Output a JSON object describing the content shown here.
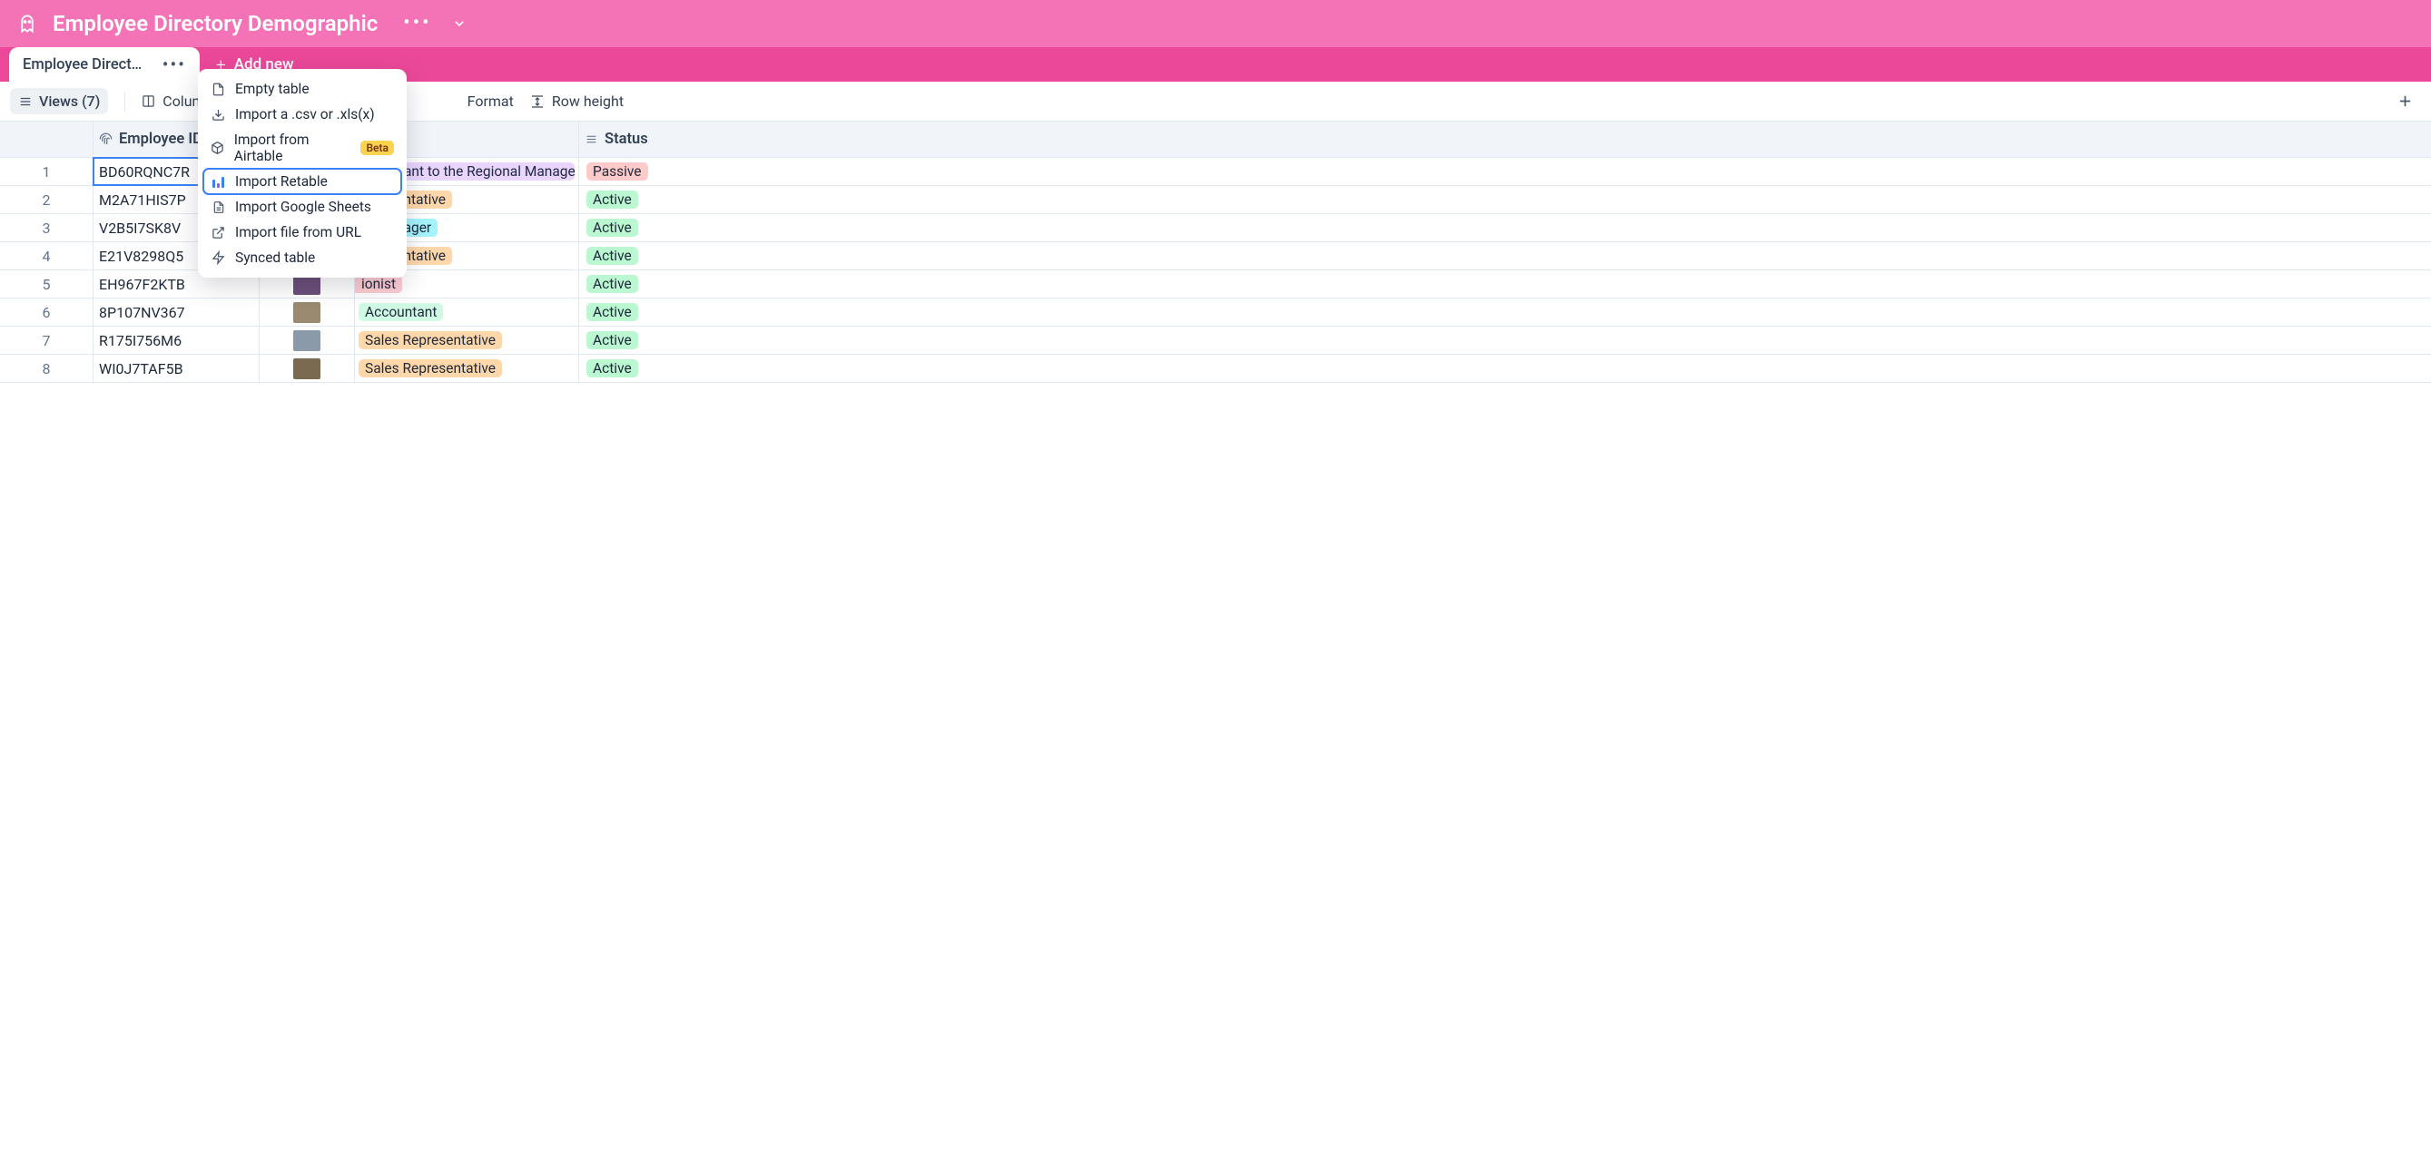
{
  "header": {
    "title": "Employee Directory Demographic"
  },
  "tabs": {
    "active": "Employee Directory Demog...",
    "add_new": "Add new"
  },
  "toolbar": {
    "views_label": "Views (7)",
    "columns": "Columns",
    "format": "Format",
    "row_height": "Row height"
  },
  "dropdown": {
    "empty_table": "Empty table",
    "import_csv": "Import a .csv or .xls(x)",
    "import_airtable": "Import from Airtable",
    "airtable_badge": "Beta",
    "import_retable": "Import Retable",
    "import_gsheets": "Import Google Sheets",
    "import_url": "Import file from URL",
    "synced_table": "Synced table"
  },
  "columns": {
    "employee_id": "Employee ID",
    "status": "Status"
  },
  "status_tags": {
    "passive": "Passive",
    "active": "Active"
  },
  "rows": [
    {
      "num": "1",
      "id": "BD60RQNC7R",
      "job": "Assistant to the Regional Manager",
      "job_class": "tag-purple",
      "status": "Passive",
      "status_class": "tag-red",
      "photo_bg": "#8b7355",
      "cut": false
    },
    {
      "num": "2",
      "id": "M2A71HIS7P",
      "job": "epresentative",
      "job_class": "tag-orange",
      "status": "Active",
      "status_class": "tag-green",
      "photo_bg": "#d4a574",
      "cut": true
    },
    {
      "num": "3",
      "id": "V2B5I7SK8V",
      "job": "al Manager",
      "job_class": "tag-cyan",
      "status": "Active",
      "status_class": "tag-green",
      "photo_bg": "#a89070",
      "cut": true
    },
    {
      "num": "4",
      "id": "E21V8298Q5",
      "job": "epresentative",
      "job_class": "tag-orange",
      "status": "Active",
      "status_class": "tag-green",
      "photo_bg": "#7a8a6a",
      "cut": true
    },
    {
      "num": "5",
      "id": "EH967F2KTB",
      "job": "ionist",
      "job_class": "tag-pink",
      "status": "Active",
      "status_class": "tag-green",
      "photo_bg": "#6b4f7a",
      "cut": true
    },
    {
      "num": "6",
      "id": "8P107NV367",
      "job": "Accountant",
      "job_class": "tag-lgreen",
      "status": "Active",
      "status_class": "tag-green",
      "photo_bg": "#9a8a70",
      "cut": false
    },
    {
      "num": "7",
      "id": "R175I756M6",
      "job": "Sales Representative",
      "job_class": "tag-orange",
      "status": "Active",
      "status_class": "tag-green",
      "photo_bg": "#8a9aa8",
      "cut": false
    },
    {
      "num": "8",
      "id": "WI0J7TAF5B",
      "job": "Sales Representative",
      "job_class": "tag-orange",
      "status": "Active",
      "status_class": "tag-green",
      "photo_bg": "#7a6a50",
      "cut": false
    }
  ]
}
